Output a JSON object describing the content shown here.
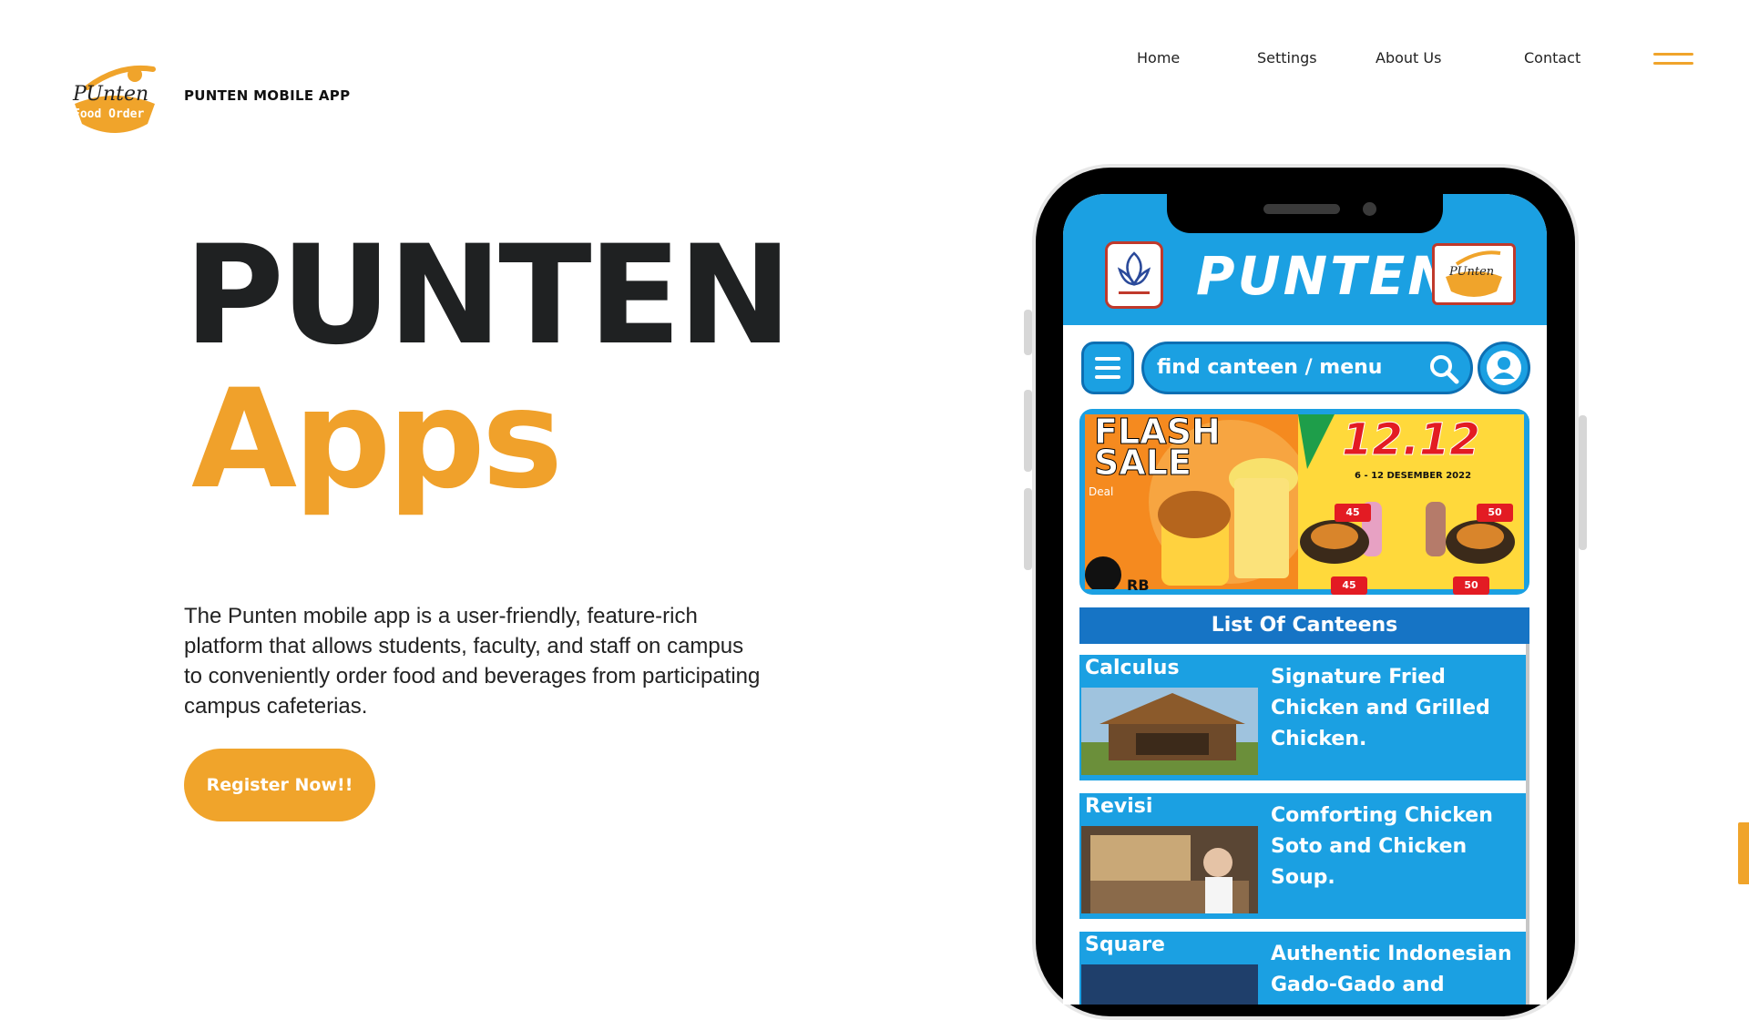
{
  "brand": {
    "name": "PUNTEN MOBILE APP",
    "logo_text_top": "PUnten",
    "logo_text_bottom": "Food Order"
  },
  "nav": {
    "items": [
      "Home",
      "Settings",
      "About Us",
      "Contact"
    ],
    "menu_icon": "hamburger-icon"
  },
  "hero": {
    "title": "PUNTEN",
    "subtitle": "Apps",
    "description": "The Punten mobile app is a user-friendly, feature-rich platform that allows students, faculty, and staff on campus to conveniently order food and beverages from participating campus cafeterias.",
    "cta_label": "Register Now!!"
  },
  "colors": {
    "accent": "#f0a42b",
    "dark": "#1f2122",
    "app_blue": "#1ba0e2",
    "app_dark_blue": "#1674c5"
  },
  "phone_app": {
    "title": "PUNTEN",
    "search_placeholder": "find canteen / menu",
    "banner": {
      "left_text": "FLASH SALE",
      "left_sub": "Deal",
      "left_badge": "RB",
      "right_text": "12.12",
      "right_sub": "6 - 12 DESEMBER 2022",
      "prices": [
        "45",
        "50",
        "45",
        "50"
      ]
    },
    "section_title": "List Of Canteens",
    "canteens": [
      {
        "name": "Calculus",
        "desc": "Signature Fried Chicken and Grilled Chicken."
      },
      {
        "name": "Revisi",
        "desc": "Comforting Chicken Soto and Chicken Soup."
      },
      {
        "name": "Square",
        "desc": "Authentic Indonesian Gado-Gado and"
      }
    ]
  }
}
